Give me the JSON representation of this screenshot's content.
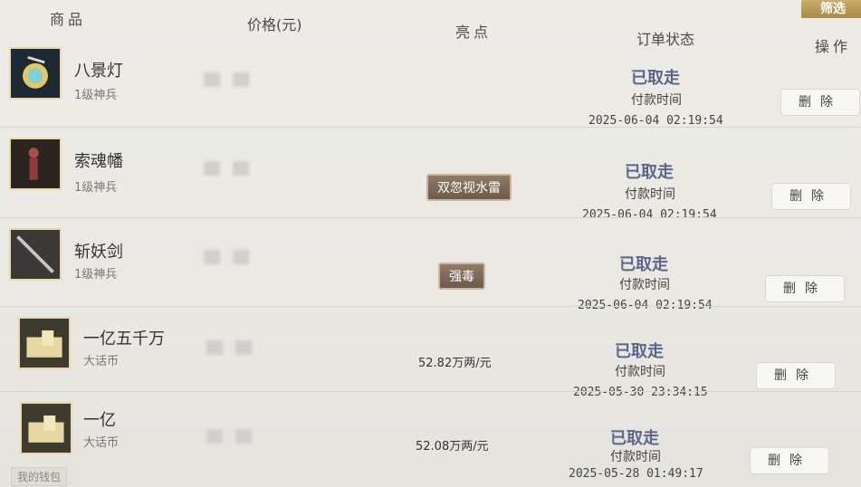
{
  "header": {
    "col_product": "商品",
    "col_price": "价格(元)",
    "col_highlight": "亮点",
    "col_status": "订单状态",
    "col_action": "操作",
    "filter_label": "筛选"
  },
  "rows": [
    {
      "name": "八景灯",
      "sub": "1级神兵",
      "highlight": "",
      "status": "已取走",
      "pay_label": "付款时间",
      "pay_time": "2025-06-04 02:19:54",
      "delete_label": "删除",
      "icon": "lantern-icon"
    },
    {
      "name": "索魂幡",
      "sub": "1级神兵",
      "highlight": "双忽视水雷",
      "status": "已取走",
      "pay_label": "付款时间",
      "pay_time": "2025-06-04 02:19:54",
      "delete_label": "删除",
      "icon": "banner-icon"
    },
    {
      "name": "斩妖剑",
      "sub": "1级神兵",
      "highlight": "强毒",
      "status": "已取走",
      "pay_label": "付款时间",
      "pay_time": "2025-06-04 02:19:54",
      "delete_label": "删除",
      "icon": "sword-icon"
    },
    {
      "name": "一亿五千万",
      "sub": "大话币",
      "highlight": "52.82万两/元",
      "status": "已取走",
      "pay_label": "付款时间",
      "pay_time": "2025-05-30 23:34:15",
      "delete_label": "删除",
      "icon": "coin-stack-icon"
    },
    {
      "name": "一亿",
      "sub": "大话币",
      "highlight": "52.08万两/元",
      "status": "已取走",
      "pay_label": "付款时间",
      "pay_time": "2025-05-28 01:49:17",
      "delete_label": "删除",
      "icon": "coin-stack-icon"
    }
  ],
  "footer": {
    "wallet_label": "我的钱包"
  }
}
